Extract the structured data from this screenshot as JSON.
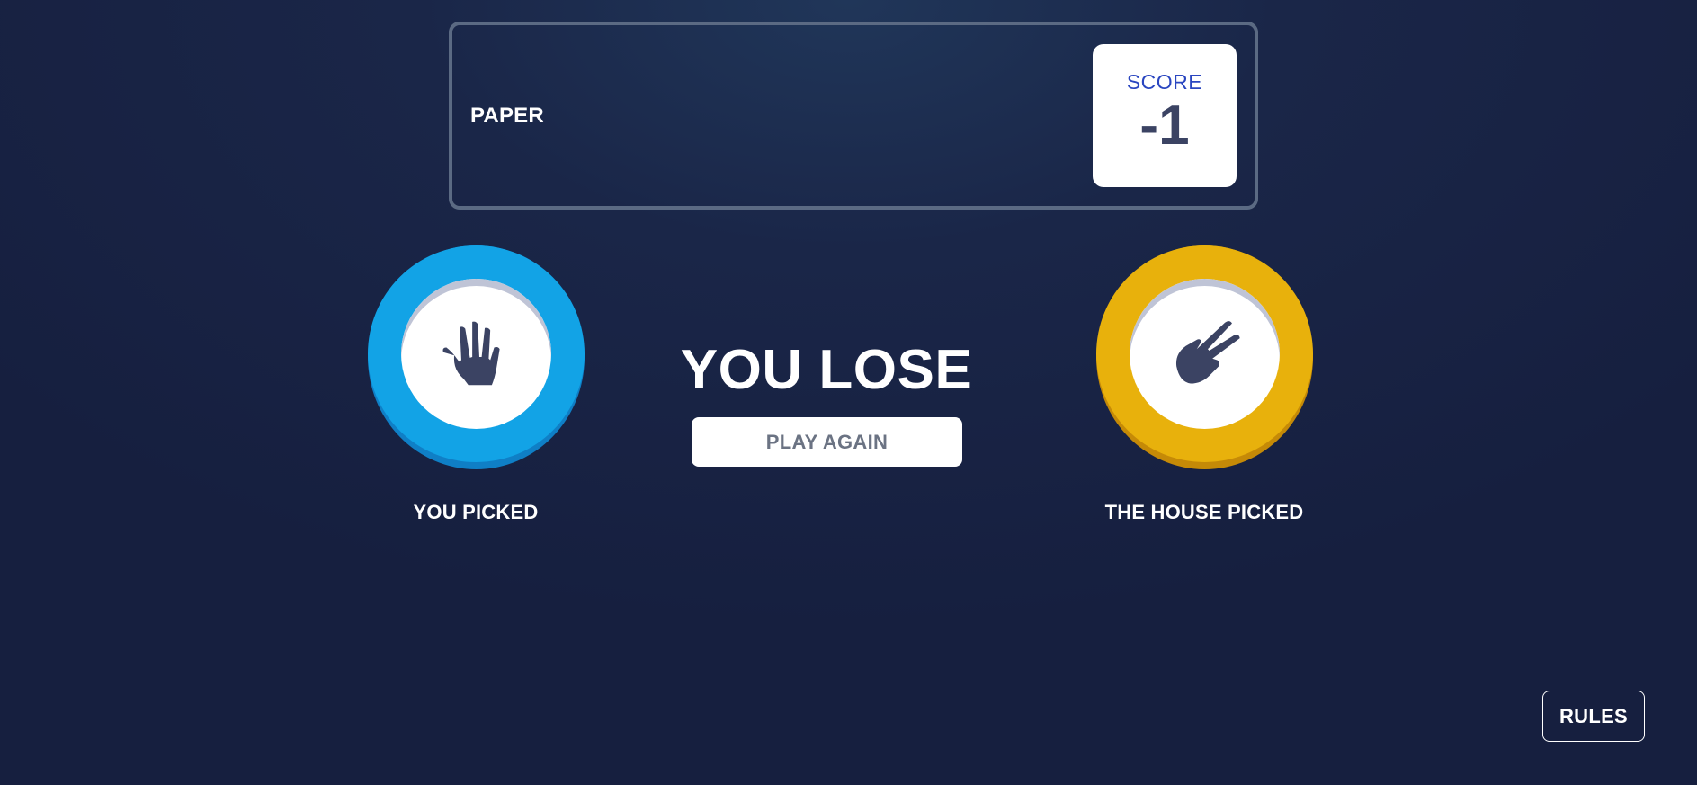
{
  "header": {
    "title": "PAPER",
    "score_label": "SCORE",
    "score_value": "-1"
  },
  "player": {
    "choice": "paper",
    "choice_icon": "hand-paper-icon",
    "label": "YOU PICKED",
    "color": "#12a3e6"
  },
  "house": {
    "choice": "scissors",
    "choice_icon": "hand-scissors-icon",
    "label": "THE HOUSE PICKED",
    "color": "#e8b10c"
  },
  "result": {
    "text": "YOU LOSE",
    "play_again_label": "PLAY AGAIN"
  },
  "footer": {
    "rules_label": "RULES"
  },
  "colors": {
    "icon": "#3b4363",
    "score_label": "#2a46c0"
  }
}
